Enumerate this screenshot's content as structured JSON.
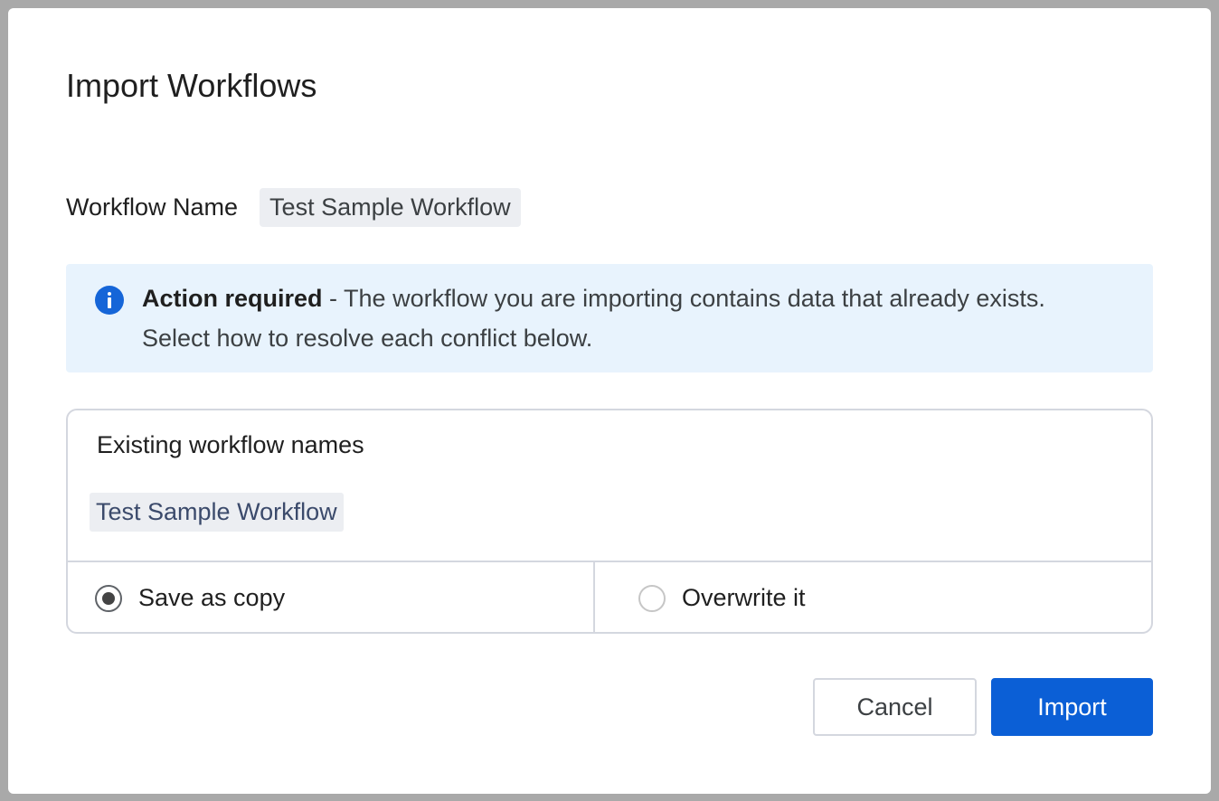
{
  "dialog": {
    "title": "Import Workflows",
    "workflow_name_label": "Workflow Name",
    "workflow_name_value": "Test Sample Workflow"
  },
  "alert": {
    "icon": "info-icon",
    "strong": "Action required",
    "message_line1": " - The workflow you are importing contains data that already exists.",
    "message_line2": "Select how to resolve each conflict below."
  },
  "conflict": {
    "heading": "Existing workflow names",
    "item": "Test Sample Workflow",
    "options": [
      {
        "label": "Save as copy",
        "selected": true
      },
      {
        "label": "Overwrite it",
        "selected": false
      }
    ]
  },
  "actions": {
    "cancel_label": "Cancel",
    "import_label": "Import"
  },
  "colors": {
    "primary": "#0b5fd6",
    "info_bg": "#e8f3fd",
    "info_icon": "#1565d8",
    "chip_bg": "#eceef2"
  }
}
